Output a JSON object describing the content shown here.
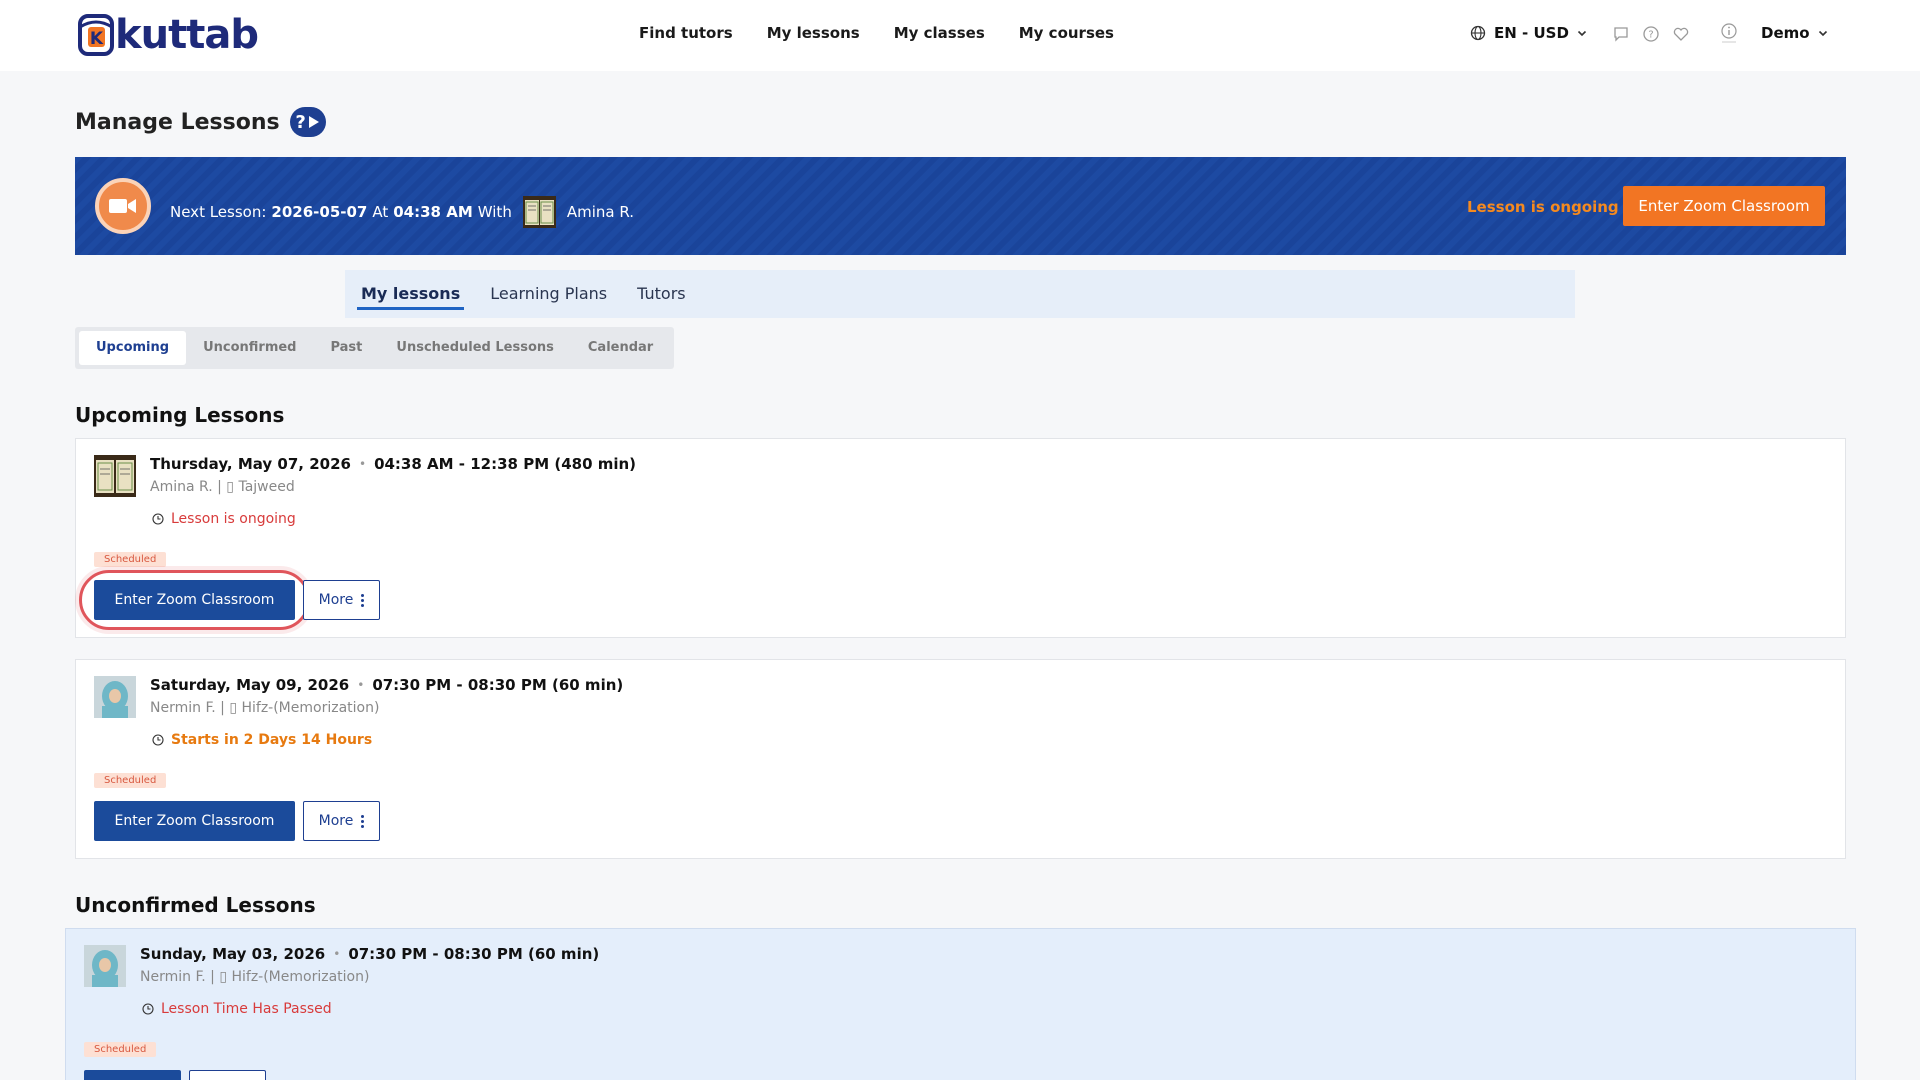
{
  "brand": {
    "name": "kuttab",
    "accent": "#1e2a7a",
    "orange": "#f27523",
    "blue": "#1b4b9b"
  },
  "nav": {
    "items": [
      "Find tutors",
      "My lessons",
      "My classes",
      "My courses"
    ]
  },
  "header": {
    "locale": "EN - USD",
    "user": "Demo"
  },
  "page": {
    "title": "Manage Lessons",
    "help_badge": "?"
  },
  "banner": {
    "prefix": "Next Lesson:",
    "date": "2026-05-07",
    "at": "At",
    "time": "04:38 AM",
    "with": "With",
    "tutor": "Amina R.",
    "status": "Lesson is ongoing",
    "button": "Enter Zoom Classroom"
  },
  "main_tabs": [
    "My lessons",
    "Learning Plans",
    "Tutors"
  ],
  "sub_tabs": [
    "Upcoming",
    "Unconfirmed",
    "Past",
    "Unscheduled Lessons",
    "Calendar"
  ],
  "sections": {
    "upcoming": "Upcoming Lessons",
    "unconfirmed": "Unconfirmed Lessons"
  },
  "lessons": [
    {
      "day": "Thursday, May 07, 2026",
      "time": "04:38 AM - 12:38 PM (480 min)",
      "sub": "Amina R. | ▯ Tajweed",
      "status": "Lesson is ongoing",
      "badge": "Scheduled",
      "primary": "Enter Zoom Classroom",
      "more": "More"
    },
    {
      "day": "Saturday, May 09, 2026",
      "time": "07:30 PM - 08:30 PM (60 min)",
      "sub": "Nermin F. | ▯ Hifz-(Memorization)",
      "status": "Starts in 2 Days 14 Hours",
      "badge": "Scheduled",
      "primary": "Enter Zoom Classroom",
      "more": "More"
    }
  ],
  "unconfirmed": [
    {
      "day": "Sunday, May 03, 2026",
      "time": "07:30 PM - 08:30 PM (60 min)",
      "sub": "Nermin F. | ▯ Hifz-(Memorization)",
      "status": "Lesson Time Has Passed",
      "badge": "Scheduled"
    }
  ]
}
